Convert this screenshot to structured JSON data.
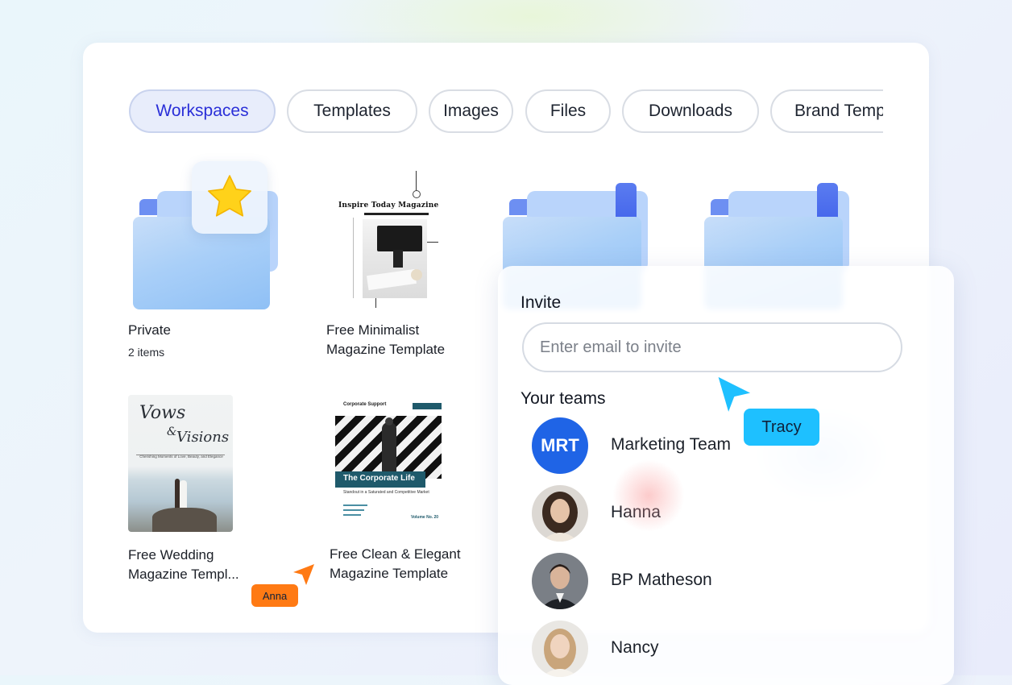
{
  "tabs": [
    {
      "label": "Workspaces",
      "active": true
    },
    {
      "label": "Templates"
    },
    {
      "label": "Images"
    },
    {
      "label": "Files"
    },
    {
      "label": "Downloads"
    },
    {
      "label": "Brand Templates"
    }
  ],
  "items": [
    {
      "title": "Private",
      "subtitle": "2 items",
      "icon": "star-folder-icon"
    },
    {
      "title_line1": "Free Minimalist",
      "title_line2": "Magazine Template",
      "thumb_title": "Inspire Today Magazine"
    },
    {
      "title_line1": "Free Wedding",
      "title_line2": "Magazine Templ...",
      "thumb_title1": "Vows",
      "thumb_amp": "&",
      "thumb_title2": "Visions",
      "thumb_sub": "Cherishing Moments of Love, Beauty, and Elegance"
    },
    {
      "title_line1": "Free Clean & Elegant",
      "title_line2": "Magazine Template",
      "thumb_header": "Corporate Support",
      "thumb_title": "The Corporate Life",
      "thumb_sub": "Standout in a Saturated and Competitive Market",
      "thumb_vol": "Volume No. 20"
    }
  ],
  "invite": {
    "heading": "Invite",
    "placeholder": "Enter email to invite",
    "teams_heading": "Your teams",
    "teams": [
      {
        "name": "Marketing Team",
        "initials": "MRT"
      },
      {
        "name": "Hanna"
      },
      {
        "name": "BP Matheson"
      },
      {
        "name": "Nancy"
      }
    ]
  },
  "cursors": [
    {
      "name": "Tracy",
      "color": "#1ec0ff"
    },
    {
      "name": "Anna",
      "color": "#ff7a14"
    }
  ],
  "colors": {
    "accent": "#2a2fd8",
    "folder": "#a9cff8",
    "team_avatar": "#1f64e6"
  }
}
